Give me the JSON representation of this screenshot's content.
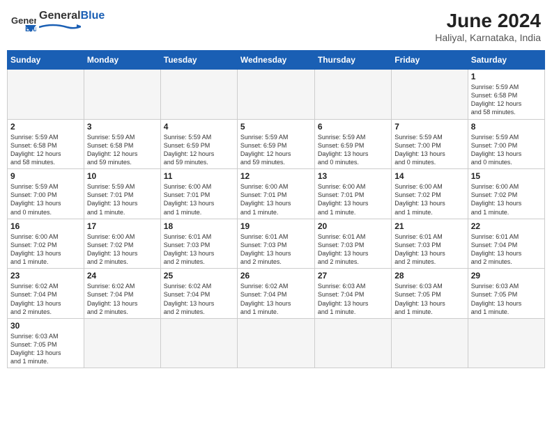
{
  "header": {
    "logo_general": "General",
    "logo_blue": "Blue",
    "month_year": "June 2024",
    "location": "Haliyal, Karnataka, India"
  },
  "days_of_week": [
    "Sunday",
    "Monday",
    "Tuesday",
    "Wednesday",
    "Thursday",
    "Friday",
    "Saturday"
  ],
  "weeks": [
    [
      {
        "day": "",
        "info": ""
      },
      {
        "day": "",
        "info": ""
      },
      {
        "day": "",
        "info": ""
      },
      {
        "day": "",
        "info": ""
      },
      {
        "day": "",
        "info": ""
      },
      {
        "day": "",
        "info": ""
      },
      {
        "day": "1",
        "info": "Sunrise: 5:59 AM\nSunset: 6:58 PM\nDaylight: 12 hours\nand 58 minutes."
      }
    ],
    [
      {
        "day": "2",
        "info": "Sunrise: 5:59 AM\nSunset: 6:58 PM\nDaylight: 12 hours\nand 58 minutes."
      },
      {
        "day": "3",
        "info": "Sunrise: 5:59 AM\nSunset: 6:58 PM\nDaylight: 12 hours\nand 59 minutes."
      },
      {
        "day": "4",
        "info": "Sunrise: 5:59 AM\nSunset: 6:59 PM\nDaylight: 12 hours\nand 59 minutes."
      },
      {
        "day": "5",
        "info": "Sunrise: 5:59 AM\nSunset: 6:59 PM\nDaylight: 12 hours\nand 59 minutes."
      },
      {
        "day": "6",
        "info": "Sunrise: 5:59 AM\nSunset: 6:59 PM\nDaylight: 13 hours\nand 0 minutes."
      },
      {
        "day": "7",
        "info": "Sunrise: 5:59 AM\nSunset: 7:00 PM\nDaylight: 13 hours\nand 0 minutes."
      },
      {
        "day": "8",
        "info": "Sunrise: 5:59 AM\nSunset: 7:00 PM\nDaylight: 13 hours\nand 0 minutes."
      }
    ],
    [
      {
        "day": "9",
        "info": "Sunrise: 5:59 AM\nSunset: 7:00 PM\nDaylight: 13 hours\nand 0 minutes."
      },
      {
        "day": "10",
        "info": "Sunrise: 5:59 AM\nSunset: 7:01 PM\nDaylight: 13 hours\nand 1 minute."
      },
      {
        "day": "11",
        "info": "Sunrise: 6:00 AM\nSunset: 7:01 PM\nDaylight: 13 hours\nand 1 minute."
      },
      {
        "day": "12",
        "info": "Sunrise: 6:00 AM\nSunset: 7:01 PM\nDaylight: 13 hours\nand 1 minute."
      },
      {
        "day": "13",
        "info": "Sunrise: 6:00 AM\nSunset: 7:01 PM\nDaylight: 13 hours\nand 1 minute."
      },
      {
        "day": "14",
        "info": "Sunrise: 6:00 AM\nSunset: 7:02 PM\nDaylight: 13 hours\nand 1 minute."
      },
      {
        "day": "15",
        "info": "Sunrise: 6:00 AM\nSunset: 7:02 PM\nDaylight: 13 hours\nand 1 minute."
      }
    ],
    [
      {
        "day": "16",
        "info": "Sunrise: 6:00 AM\nSunset: 7:02 PM\nDaylight: 13 hours\nand 1 minute."
      },
      {
        "day": "17",
        "info": "Sunrise: 6:00 AM\nSunset: 7:02 PM\nDaylight: 13 hours\nand 2 minutes."
      },
      {
        "day": "18",
        "info": "Sunrise: 6:01 AM\nSunset: 7:03 PM\nDaylight: 13 hours\nand 2 minutes."
      },
      {
        "day": "19",
        "info": "Sunrise: 6:01 AM\nSunset: 7:03 PM\nDaylight: 13 hours\nand 2 minutes."
      },
      {
        "day": "20",
        "info": "Sunrise: 6:01 AM\nSunset: 7:03 PM\nDaylight: 13 hours\nand 2 minutes."
      },
      {
        "day": "21",
        "info": "Sunrise: 6:01 AM\nSunset: 7:03 PM\nDaylight: 13 hours\nand 2 minutes."
      },
      {
        "day": "22",
        "info": "Sunrise: 6:01 AM\nSunset: 7:04 PM\nDaylight: 13 hours\nand 2 minutes."
      }
    ],
    [
      {
        "day": "23",
        "info": "Sunrise: 6:02 AM\nSunset: 7:04 PM\nDaylight: 13 hours\nand 2 minutes."
      },
      {
        "day": "24",
        "info": "Sunrise: 6:02 AM\nSunset: 7:04 PM\nDaylight: 13 hours\nand 2 minutes."
      },
      {
        "day": "25",
        "info": "Sunrise: 6:02 AM\nSunset: 7:04 PM\nDaylight: 13 hours\nand 2 minutes."
      },
      {
        "day": "26",
        "info": "Sunrise: 6:02 AM\nSunset: 7:04 PM\nDaylight: 13 hours\nand 1 minute."
      },
      {
        "day": "27",
        "info": "Sunrise: 6:03 AM\nSunset: 7:04 PM\nDaylight: 13 hours\nand 1 minute."
      },
      {
        "day": "28",
        "info": "Sunrise: 6:03 AM\nSunset: 7:05 PM\nDaylight: 13 hours\nand 1 minute."
      },
      {
        "day": "29",
        "info": "Sunrise: 6:03 AM\nSunset: 7:05 PM\nDaylight: 13 hours\nand 1 minute."
      }
    ],
    [
      {
        "day": "30",
        "info": "Sunrise: 6:03 AM\nSunset: 7:05 PM\nDaylight: 13 hours\nand 1 minute."
      },
      {
        "day": "",
        "info": ""
      },
      {
        "day": "",
        "info": ""
      },
      {
        "day": "",
        "info": ""
      },
      {
        "day": "",
        "info": ""
      },
      {
        "day": "",
        "info": ""
      },
      {
        "day": "",
        "info": ""
      }
    ]
  ]
}
